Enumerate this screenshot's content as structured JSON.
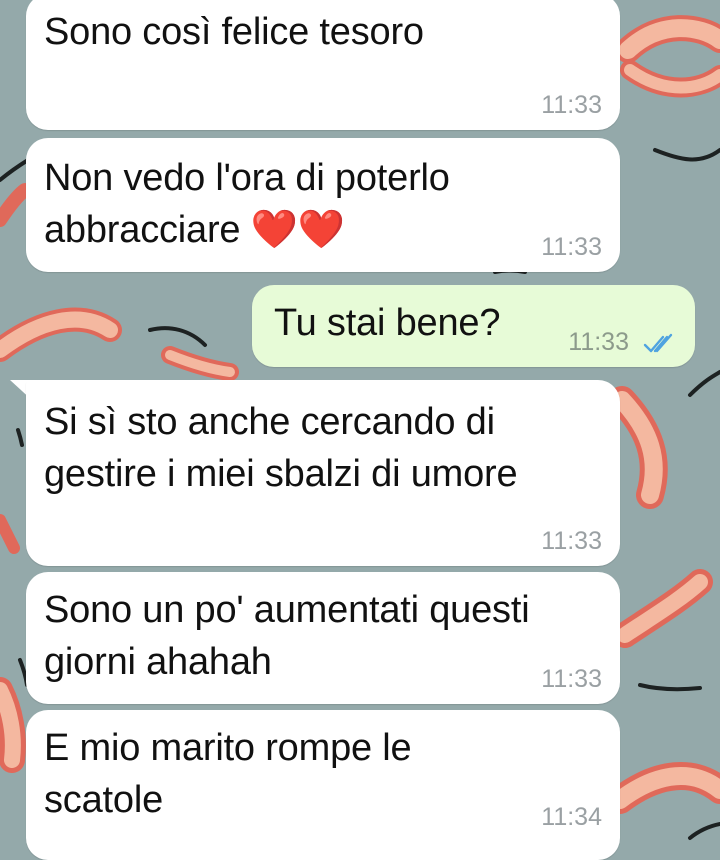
{
  "chat": {
    "messages": [
      {
        "id": "m1",
        "direction": "in",
        "text": "Sono così felice tesoro",
        "time": "11:33"
      },
      {
        "id": "m2",
        "direction": "in",
        "text": "Non vedo l'ora di poterlo\nabbracciare ❤️❤️",
        "time": "11:33"
      },
      {
        "id": "m3",
        "direction": "out",
        "text": "Tu stai bene?",
        "time": "11:33",
        "status": "read"
      },
      {
        "id": "m4",
        "direction": "in",
        "text": "Si sì sto anche cercando di\ngestire i miei sbalzi di umore",
        "time": "11:33"
      },
      {
        "id": "m5",
        "direction": "in",
        "text": "Sono un po' aumentati questi\ngiorni ahahah",
        "time": "11:33"
      },
      {
        "id": "m6",
        "direction": "in",
        "text": "E mio marito rompe le\nscatole",
        "time": "11:34"
      }
    ]
  },
  "colors": {
    "wallpaper": "#94a9aa",
    "incoming_bubble": "#ffffff",
    "outgoing_bubble": "#e7fbd7",
    "read_ticks": "#4fa3e0"
  },
  "icons": {
    "read_receipt": "double-check-icon"
  }
}
